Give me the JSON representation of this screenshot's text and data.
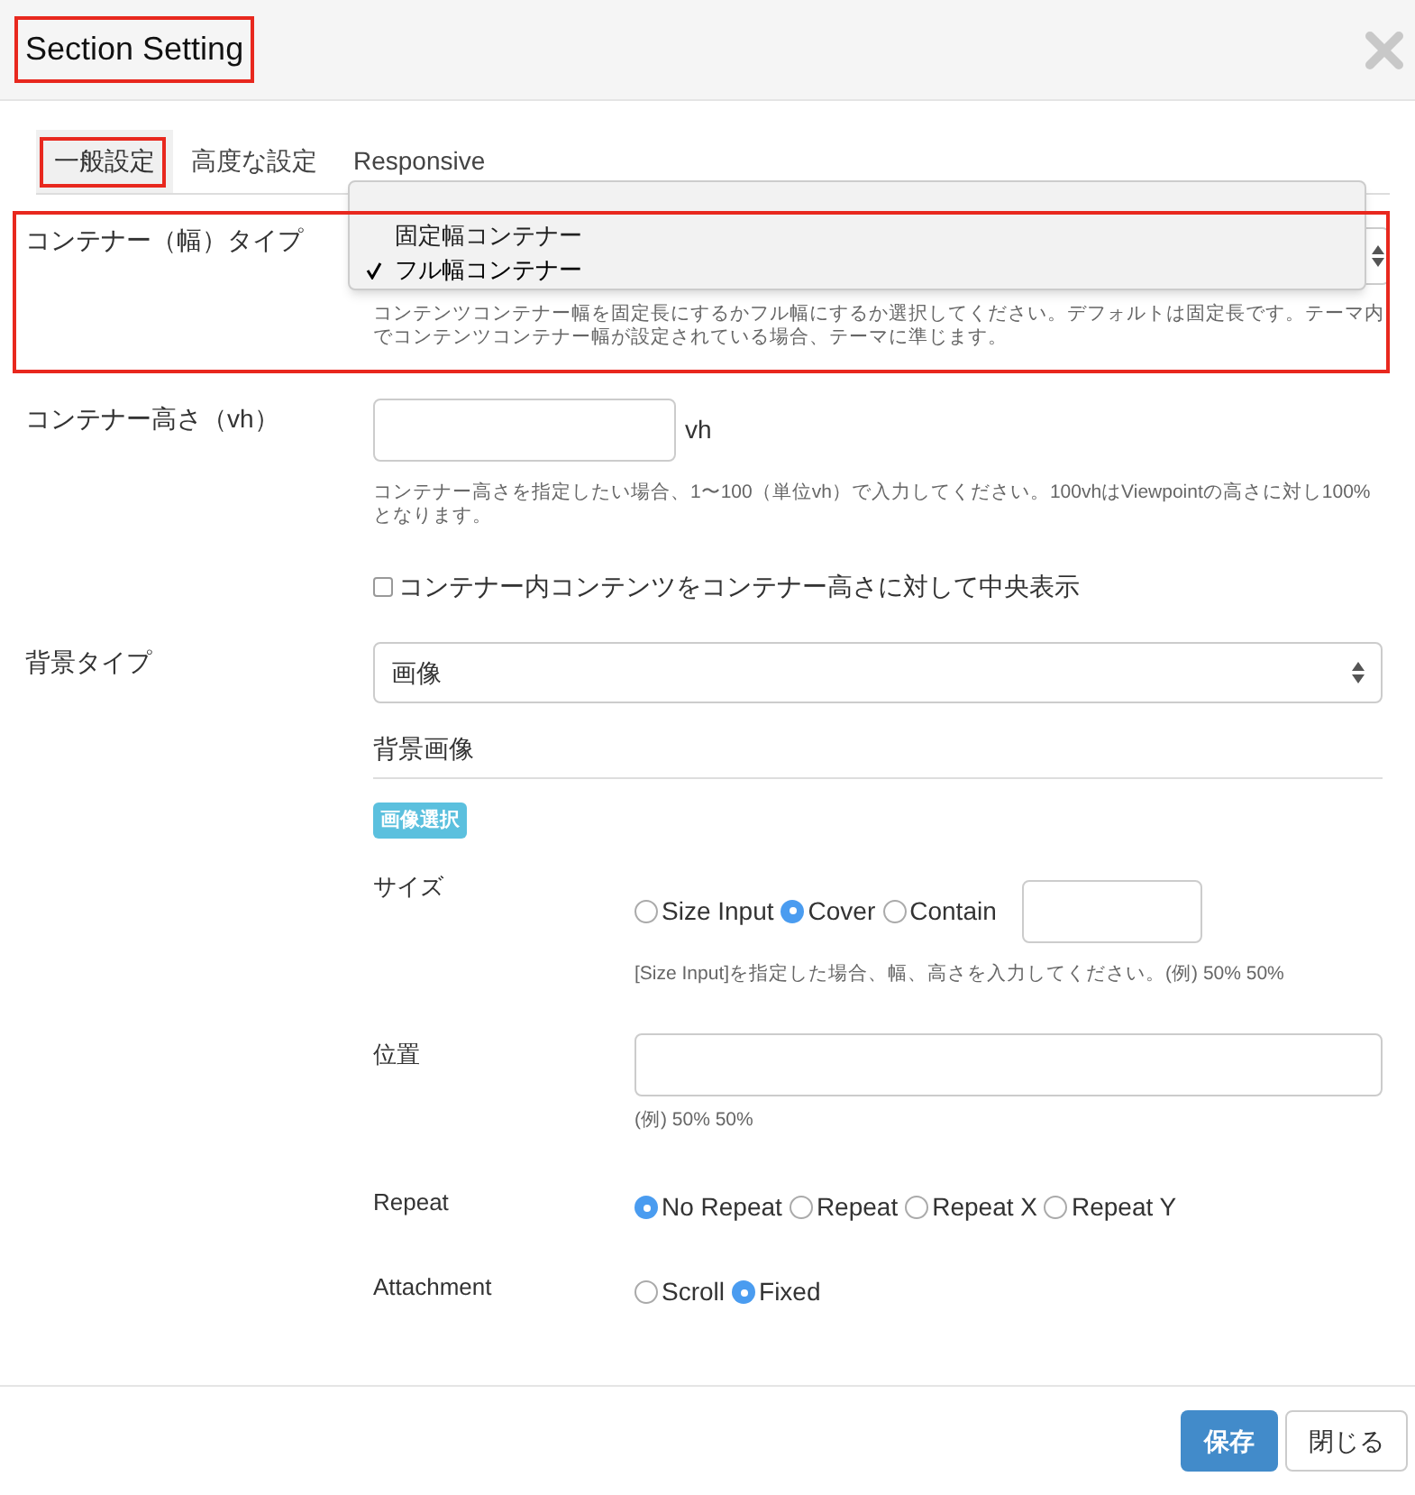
{
  "dialog": {
    "title": "Section Setting"
  },
  "tabs": [
    {
      "label": "一般設定",
      "selected": true
    },
    {
      "label": "高度な設定",
      "selected": false
    },
    {
      "label": "Responsive",
      "selected": false
    }
  ],
  "container_type": {
    "label": "コンテナー（幅）タイプ",
    "help": "コンテンツコンテナー幅を固定長にするかフル幅にするか選択してください。デフォルトは固定長です。テーマ内でコンテンツコンテナー幅が設定されている場合、テーマに準じます。",
    "menu": [
      {
        "label": "固定幅コンテナー",
        "selected": false
      },
      {
        "label": "フル幅コンテナー",
        "selected": true
      }
    ]
  },
  "container_height": {
    "label": "コンテナー高さ（vh）",
    "unit": "vh",
    "help": "コンテナー高さを指定したい場合、1〜100（単位vh）で入力してください。100vhはViewpointの高さに対し100%となります。",
    "center_checkbox": {
      "label": "コンテナー内コンテンツをコンテナー高さに対して中央表示",
      "checked": false
    }
  },
  "background_type": {
    "label": "背景タイプ",
    "value": "画像"
  },
  "background_image": {
    "heading": "背景画像",
    "select_button": "画像選択",
    "size": {
      "label": "サイズ",
      "options": [
        {
          "label": "Size Input",
          "selected": false
        },
        {
          "label": "Cover",
          "selected": true
        },
        {
          "label": "Contain",
          "selected": false
        }
      ],
      "help": "[Size Input]を指定した場合、幅、高さを入力してください。(例) 50% 50%"
    },
    "position": {
      "label": "位置",
      "help": "(例) 50% 50%"
    },
    "repeat": {
      "label": "Repeat",
      "options": [
        {
          "label": "No Repeat",
          "selected": true
        },
        {
          "label": "Repeat",
          "selected": false
        },
        {
          "label": "Repeat X",
          "selected": false
        },
        {
          "label": "Repeat Y",
          "selected": false
        }
      ]
    },
    "attachment": {
      "label": "Attachment",
      "options": [
        {
          "label": "Scroll",
          "selected": false
        },
        {
          "label": "Fixed",
          "selected": true
        }
      ]
    }
  },
  "buttons": {
    "save": "保存",
    "close": "閉じる"
  }
}
